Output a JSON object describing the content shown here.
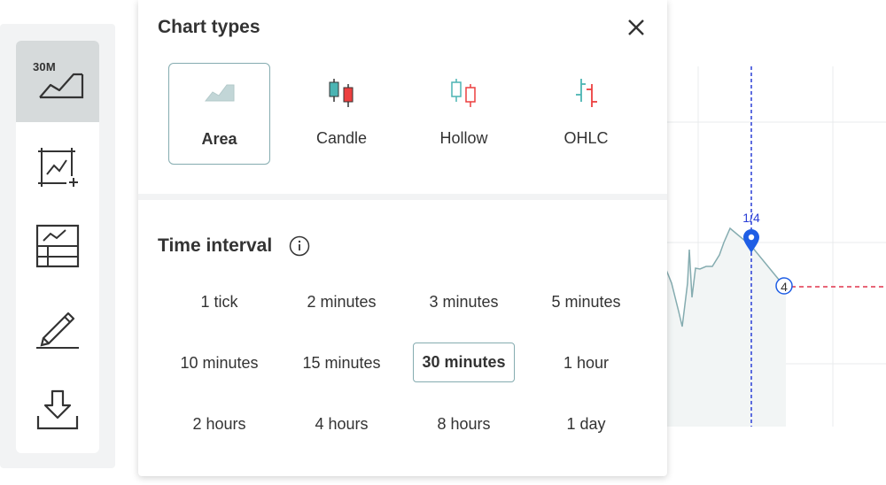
{
  "toolbar": {
    "interval_badge": "30M",
    "items": [
      {
        "name": "chart-type-interval-button",
        "icon": "area-chart-icon",
        "active": true
      },
      {
        "name": "indicators-button",
        "icon": "chart-add-icon",
        "active": false
      },
      {
        "name": "templates-button",
        "icon": "chart-template-icon",
        "active": false
      },
      {
        "name": "drawing-tools-button",
        "icon": "pencil-icon",
        "active": false
      },
      {
        "name": "download-button",
        "icon": "download-icon",
        "active": false
      }
    ]
  },
  "popup": {
    "title": "Chart types",
    "close_icon": "close-icon",
    "chart_types": [
      {
        "label": "Area",
        "icon": "area-icon",
        "selected": true
      },
      {
        "label": "Candle",
        "icon": "candle-icon",
        "selected": false
      },
      {
        "label": "Hollow",
        "icon": "hollow-candle-icon",
        "selected": false
      },
      {
        "label": "OHLC",
        "icon": "ohlc-icon",
        "selected": false
      }
    ],
    "interval_section": {
      "title": "Time interval",
      "info_icon": "info-icon",
      "intervals": [
        "1 tick",
        "2 minutes",
        "3 minutes",
        "5 minutes",
        "10 minutes",
        "15 minutes",
        "30 minutes",
        "1 hour",
        "2 hours",
        "4 hours",
        "8 hours",
        "1 day"
      ],
      "selected": "30 minutes"
    }
  },
  "chart": {
    "crosshair_label": "1/4",
    "marker_label": "4",
    "colors": {
      "line": "#85acb0",
      "fill": "#f2f5f5",
      "crosshair": "#2a3fd6",
      "barrier": "#e1344c",
      "accent_green": "#4bb4b3",
      "accent_red": "#ec3f3f"
    }
  }
}
